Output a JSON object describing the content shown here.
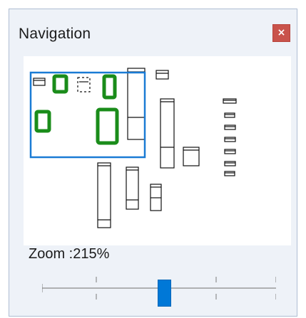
{
  "panel": {
    "title": "Navigation",
    "close_glyph": "×",
    "close_icon": "close-icon"
  },
  "zoom": {
    "label": "Zoom :215%",
    "percent": 215
  },
  "colors": {
    "viewport_border": "#1a7bd4",
    "highlight_component": "#1a8c1a",
    "slider_thumb": "#0078d7",
    "close_button": "#c9534b"
  }
}
